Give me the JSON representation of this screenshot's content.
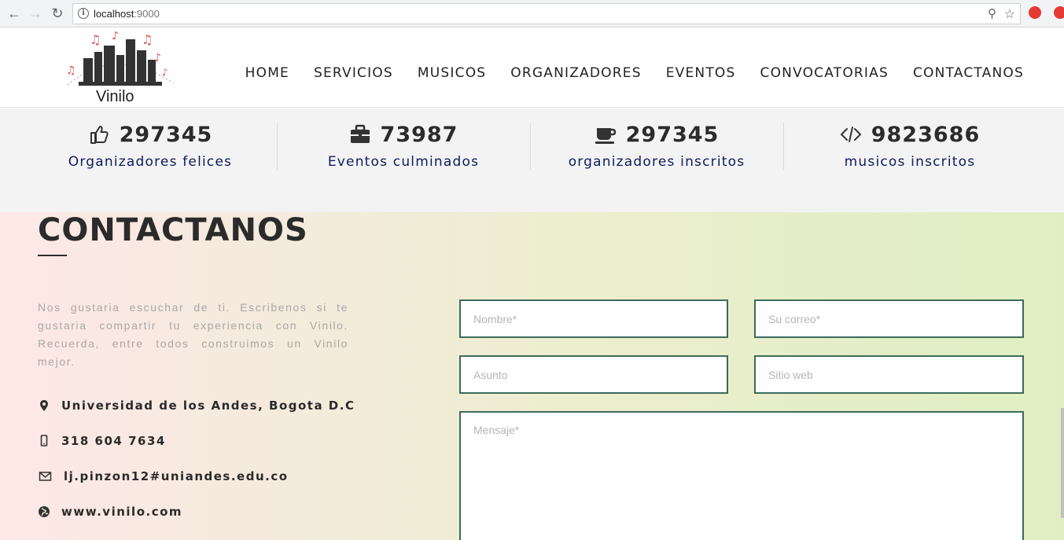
{
  "browser": {
    "url_host": "localhost",
    "url_port": ":9000"
  },
  "header": {
    "logo_text": "Vinilo",
    "nav": [
      "HOME",
      "SERVICIOS",
      "MUSICOS",
      "ORGANIZADORES",
      "EVENTOS",
      "CONVOCATORIAS",
      "CONTACTANOS"
    ]
  },
  "stats": [
    {
      "icon": "thumbs-up-icon",
      "number": "297345",
      "label": "Organizadores felices"
    },
    {
      "icon": "briefcase-icon",
      "number": "73987",
      "label": "Eventos culminados"
    },
    {
      "icon": "coffee-icon",
      "number": "297345",
      "label": "organizadores inscritos"
    },
    {
      "icon": "code-icon",
      "number": "9823686",
      "label": "musicos inscritos"
    }
  ],
  "contact": {
    "title": "CONTACTANOS",
    "intro": "Nos gustaria escuchar de ti. Escribenos si te gustaria compartir tu experiencia con Vinilo. Recuerda, entre todos construimos un Vinilo mejor.",
    "address": "Universidad de los Andes, Bogota D.C",
    "phone": "318 604 7634",
    "email": "lj.pinzon12#uniandes.edu.co",
    "website": "www.vinilo.com",
    "form": {
      "name_placeholder": "Nombre*",
      "email_placeholder": "Su correo*",
      "subject_placeholder": "Asunto",
      "website_placeholder": "Sitio web",
      "message_placeholder": "Mensaje*"
    }
  },
  "colors": {
    "accent_navy": "#0d1b5e",
    "field_border": "#3d6b5a",
    "logo_note_red": "#d9534f"
  }
}
